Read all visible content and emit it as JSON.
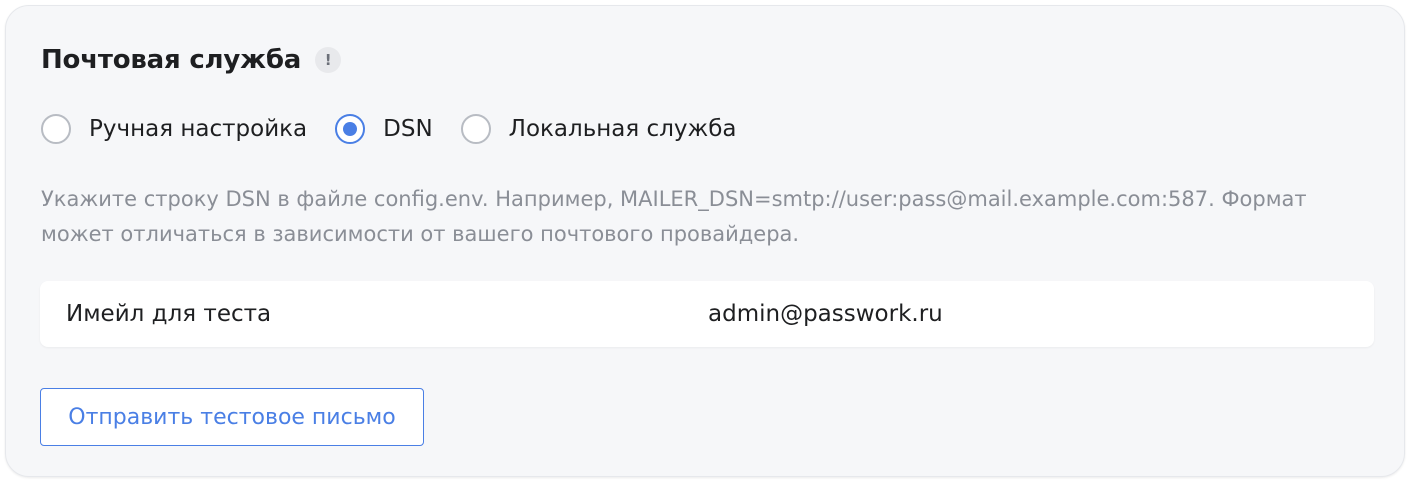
{
  "section": {
    "title": "Почтовая служба",
    "info_icon": "exclamation-icon",
    "info_glyph": "!"
  },
  "mail_mode": {
    "selected": "dsn",
    "options": [
      {
        "id": "manual",
        "label": "Ручная настройка",
        "checked": false
      },
      {
        "id": "dsn",
        "label": "DSN",
        "checked": true
      },
      {
        "id": "local",
        "label": "Локальная служба",
        "checked": false
      }
    ]
  },
  "hint": {
    "text": "Укажите строку DSN в файле config.env. Например, MAILER_DSN=smtp://user:pass@mail.example.com:587. Формат может отличаться в зависимости от вашего почтового провайдера."
  },
  "test_email": {
    "label": "Имейл для теста",
    "value": "admin@passwork.ru"
  },
  "actions": {
    "send_test_label": "Отправить тестовое письмо"
  },
  "colors": {
    "accent": "#4a7fe5",
    "panel_background": "#f6f7f9",
    "hint_text": "#8a8e96",
    "primary_text": "#1e1f21"
  }
}
